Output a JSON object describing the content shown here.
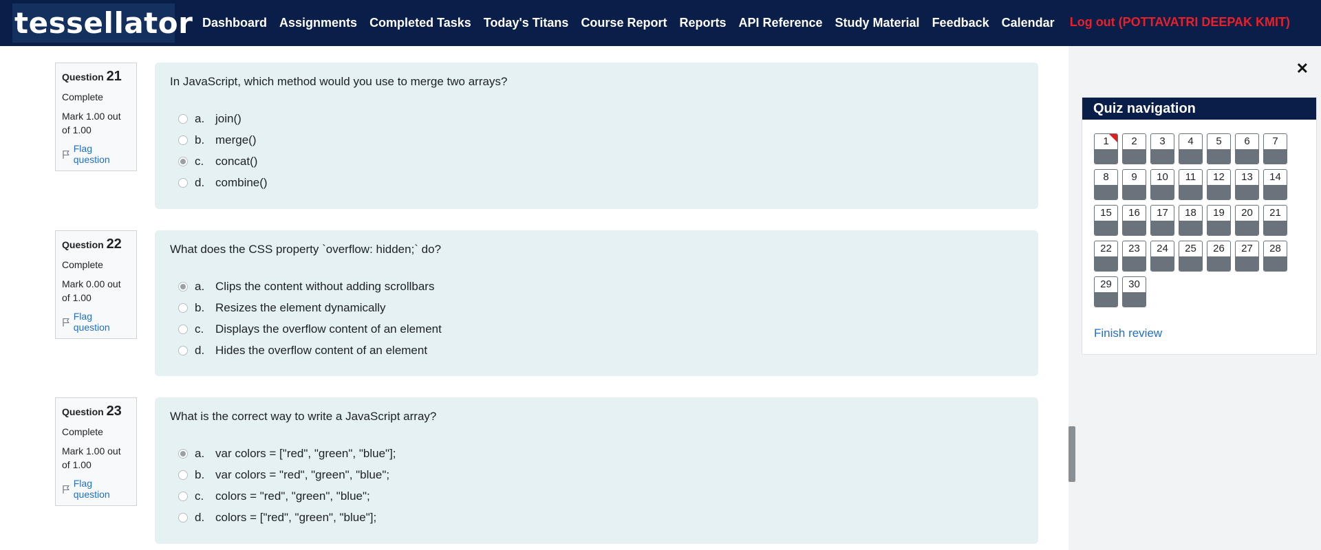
{
  "brand": "tessellator",
  "nav": [
    "Dashboard",
    "Assignments",
    "Completed Tasks",
    "Today's Titans",
    "Course Report",
    "Reports",
    "API Reference",
    "Study Material",
    "Feedback",
    "Calendar"
  ],
  "logout": "Log out (POTTAVATRI DEEPAK KMIT)",
  "questions": [
    {
      "label": "Question",
      "number": "21",
      "state": "Complete",
      "mark": "Mark 1.00 out of 1.00",
      "flag": "Flag question",
      "text": "In JavaScript, which method would you use to merge two arrays?",
      "answers": [
        {
          "letter": "a.",
          "text": "join()",
          "checked": false
        },
        {
          "letter": "b.",
          "text": "merge()",
          "checked": false
        },
        {
          "letter": "c.",
          "text": "concat()",
          "checked": true
        },
        {
          "letter": "d.",
          "text": "combine()",
          "checked": false
        }
      ]
    },
    {
      "label": "Question",
      "number": "22",
      "state": "Complete",
      "mark": "Mark 0.00 out of 1.00",
      "flag": "Flag question",
      "text": "What does the CSS property `overflow: hidden;` do?",
      "answers": [
        {
          "letter": "a.",
          "text": "Clips the content without adding scrollbars",
          "checked": true
        },
        {
          "letter": "b.",
          "text": "Resizes the element dynamically",
          "checked": false
        },
        {
          "letter": "c.",
          "text": "Displays the overflow content of an element",
          "checked": false
        },
        {
          "letter": "d.",
          "text": "Hides the overflow content of an element",
          "checked": false
        }
      ]
    },
    {
      "label": "Question",
      "number": "23",
      "state": "Complete",
      "mark": "Mark 1.00 out of 1.00",
      "flag": "Flag question",
      "text": "What is the correct way to write a JavaScript array?",
      "answers": [
        {
          "letter": "a.",
          "text": "var colors = [\"red\", \"green\", \"blue\"];",
          "checked": true
        },
        {
          "letter": "b.",
          "text": "var colors = \"red\", \"green\", \"blue\";",
          "checked": false
        },
        {
          "letter": "c.",
          "text": "colors = \"red\", \"green\", \"blue\";",
          "checked": false
        },
        {
          "letter": "d.",
          "text": "colors = [\"red\", \"green\", \"blue\"];",
          "checked": false
        }
      ]
    }
  ],
  "drawer": {
    "close_icon": "close-icon",
    "title": "Quiz navigation",
    "buttons": [
      "1",
      "2",
      "3",
      "4",
      "5",
      "6",
      "7",
      "8",
      "9",
      "10",
      "11",
      "12",
      "13",
      "14",
      "15",
      "16",
      "17",
      "18",
      "19",
      "20",
      "21",
      "22",
      "23",
      "24",
      "25",
      "26",
      "27",
      "28",
      "29",
      "30"
    ],
    "flagged": [
      "1"
    ],
    "finish": "Finish review"
  },
  "colors": {
    "navbar": "#0a1e4a",
    "logout": "#e8202a",
    "link": "#1f6fc5",
    "formulation_bg": "#e5f1f3",
    "answered": "#6a737b",
    "flag_marker": "#e02020"
  }
}
